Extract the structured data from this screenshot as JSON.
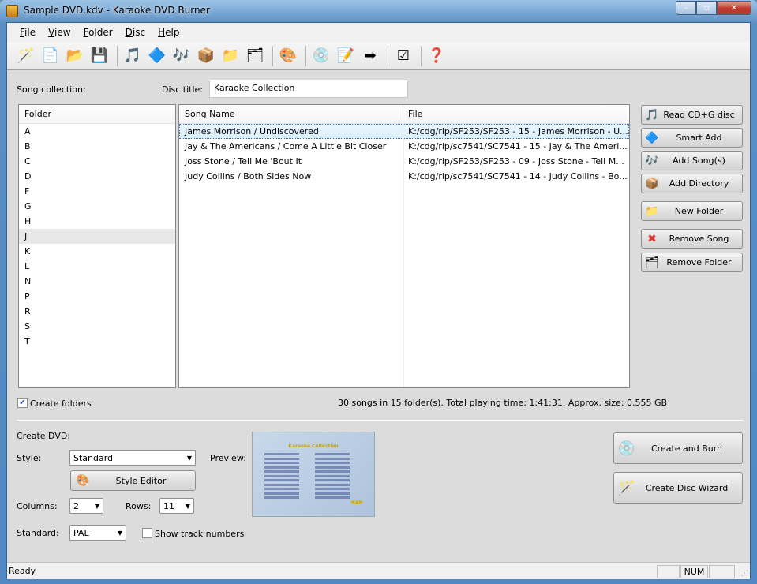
{
  "window": {
    "title": "Sample DVD.kdv - Karaoke DVD Burner",
    "min": "–",
    "max": "▫",
    "close": "✕"
  },
  "menu": [
    "File",
    "View",
    "Folder",
    "Disc",
    "Help"
  ],
  "toolbar": [
    {
      "name": "wizard-icon",
      "glyph": "🪄"
    },
    {
      "name": "new-icon",
      "glyph": "📄"
    },
    {
      "name": "open-icon",
      "glyph": "📂"
    },
    {
      "name": "save-icon",
      "glyph": "💾"
    },
    {
      "sep": true
    },
    {
      "name": "read-cdg-icon",
      "glyph": "🎵"
    },
    {
      "name": "smart-add-icon",
      "glyph": "🔷"
    },
    {
      "name": "add-song-icon",
      "glyph": "🎶"
    },
    {
      "name": "add-directory-icon",
      "glyph": "📦"
    },
    {
      "name": "new-folder-icon",
      "glyph": "📁"
    },
    {
      "name": "remove-folder-icon",
      "glyph": "🗂"
    },
    {
      "sep": true
    },
    {
      "name": "style-editor-icon",
      "glyph": "🎨"
    },
    {
      "sep": true
    },
    {
      "name": "burn-icon",
      "glyph": "💿"
    },
    {
      "name": "edit-disc-icon",
      "glyph": "📝"
    },
    {
      "name": "next-icon",
      "glyph": "➡"
    },
    {
      "sep": true
    },
    {
      "name": "checklist-icon",
      "glyph": "☑"
    },
    {
      "sep": true
    },
    {
      "name": "help-icon",
      "glyph": "❓"
    }
  ],
  "collection": {
    "song_collection_label": "Song collection:",
    "disc_title_label": "Disc title:",
    "disc_title_value": "Karaoke Collection"
  },
  "folders": {
    "header": "Folder",
    "items": [
      "A",
      "B",
      "C",
      "D",
      "F",
      "G",
      "H",
      "J",
      "K",
      "L",
      "N",
      "P",
      "R",
      "S",
      "T"
    ],
    "selected": "J"
  },
  "songs": {
    "headers": [
      "Song Name",
      "File"
    ],
    "rows": [
      {
        "name": "James Morrison / Undiscovered",
        "file": "K:/cdg/rip/SF253/SF253 - 15 - James Morrison - U..."
      },
      {
        "name": "Jay & The Americans / Come A Little Bit Closer",
        "file": "K:/cdg/rip/sc7541/SC7541 - 15 - Jay & The Ameri..."
      },
      {
        "name": "Joss Stone / Tell Me 'Bout It",
        "file": "K:/cdg/rip/SF253/SF253 - 09 - Joss Stone - Tell M..."
      },
      {
        "name": "Judy Collins / Both Sides Now",
        "file": "K:/cdg/rip/sc7541/SC7541 - 14 - Judy Collins - Bo..."
      }
    ]
  },
  "side_buttons": [
    {
      "label": "Read CD+G disc",
      "icon": "read-cdg-icon",
      "glyph": "🎵"
    },
    {
      "label": "Smart Add",
      "icon": "smart-add-icon",
      "glyph": "🔷"
    },
    {
      "label": "Add Song(s)",
      "icon": "add-song-icon",
      "glyph": "🎶"
    },
    {
      "label": "Add Directory",
      "icon": "add-directory-icon",
      "glyph": "📦"
    },
    {
      "label": "New Folder",
      "icon": "new-folder-icon",
      "glyph": "📁"
    },
    {
      "label": "Remove Song",
      "icon": "remove-song-icon",
      "glyph": "✖"
    },
    {
      "label": "Remove Folder",
      "icon": "remove-folder-icon",
      "glyph": "🗂"
    }
  ],
  "create_folders": {
    "label": "Create folders",
    "checked": true
  },
  "summary": "30 songs in 15 folder(s). Total playing time: 1:41:31. Approx. size: 0.555 GB",
  "dvd": {
    "section_label": "Create DVD:",
    "style_label": "Style:",
    "style_value": "Standard",
    "style_editor": "Style Editor",
    "preview_label": "Preview:",
    "columns_label": "Columns:",
    "columns_value": "2",
    "rows_label": "Rows:",
    "rows_value": "11",
    "standard_label": "Standard:",
    "standard_value": "PAL",
    "show_track_numbers": "Show track numbers",
    "show_track_checked": false,
    "preview_title": "Karaoke Collection"
  },
  "actions": {
    "create_burn": "Create and Burn",
    "create_wizard": "Create Disc Wizard"
  },
  "statusbar": {
    "text": "Ready",
    "num": "NUM"
  }
}
